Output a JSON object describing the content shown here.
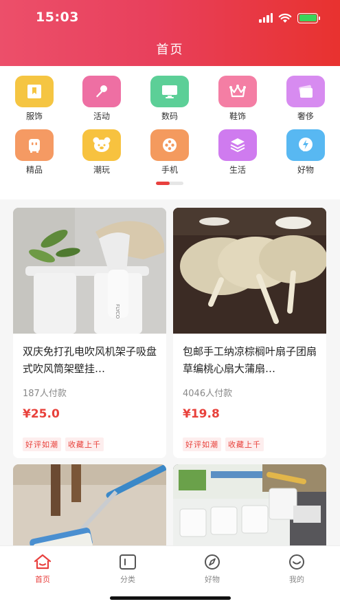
{
  "status_bar": {
    "time": "15:03"
  },
  "header": {
    "title": "首页"
  },
  "categories": [
    {
      "label": "服饰",
      "icon": "bookmark-icon",
      "color": "#f5c542"
    },
    {
      "label": "活动",
      "icon": "microphone-icon",
      "color": "#ee6fa3"
    },
    {
      "label": "数码",
      "icon": "monitor-icon",
      "color": "#5ccf97"
    },
    {
      "label": "鞋饰",
      "icon": "crown-icon",
      "color": "#f47ea4"
    },
    {
      "label": "奢侈",
      "icon": "cards-icon",
      "color": "#d78bf0"
    },
    {
      "label": "精品",
      "icon": "robot-icon",
      "color": "#f59a63"
    },
    {
      "label": "潮玩",
      "icon": "bear-icon",
      "color": "#f7c23f"
    },
    {
      "label": "手机",
      "icon": "film-reel-icon",
      "color": "#f49a5e"
    },
    {
      "label": "生活",
      "icon": "layers-icon",
      "color": "#cf7bef"
    },
    {
      "label": "好物",
      "icon": "lightning-icon",
      "color": "#58b8f2"
    }
  ],
  "products": [
    {
      "title": "双庆免打孔电吹风机架子吸盘式吹风筒架壁挂…",
      "sales": "187人付款",
      "price": "¥25.0",
      "tags": [
        "好评如潮",
        "收藏上千"
      ],
      "image": "hair-dryer-holder-photo"
    },
    {
      "title": "包邮手工纳凉棕榈叶扇子团扇草编桃心扇大蒲扇…",
      "sales": "4046人付款",
      "price": "¥19.8",
      "tags": [
        "好评如潮",
        "收藏上千"
      ],
      "image": "woven-palm-fan-photo"
    },
    {
      "image": "mop-photo"
    },
    {
      "image": "ice-cube-mold-photo"
    }
  ],
  "tabbar": {
    "tabs": [
      {
        "label": "首页",
        "icon": "home-icon",
        "active": true
      },
      {
        "label": "分类",
        "icon": "category-icon",
        "active": false
      },
      {
        "label": "好物",
        "icon": "compass-icon",
        "active": false
      },
      {
        "label": "我的",
        "icon": "smile-icon",
        "active": false
      }
    ]
  },
  "colors": {
    "accent": "#e8403e",
    "header_start": "#ec4f6a",
    "header_end": "#e8322f"
  }
}
